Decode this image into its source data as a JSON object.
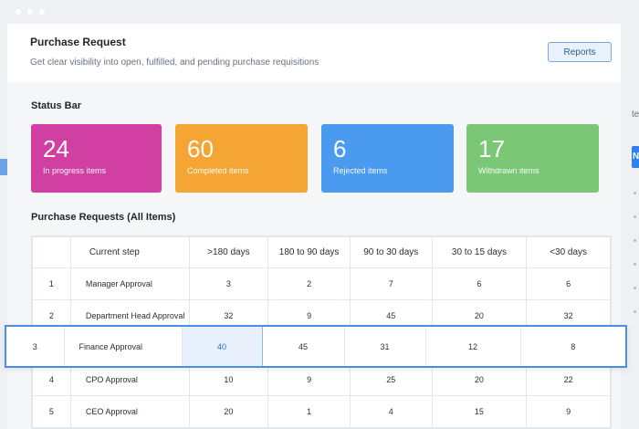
{
  "header": {
    "title": "Purchase Request",
    "subtitle": "Get clear visibility into open, fulfilled, and pending purchase requisitions",
    "reports_label": "Reports"
  },
  "status": {
    "title": "Status Bar",
    "cards": [
      {
        "value": "24",
        "label": "In progress items",
        "color": "#d13fa3"
      },
      {
        "value": "60",
        "label": "Completed items",
        "color": "#f5a534"
      },
      {
        "value": "6",
        "label": "Rejected items",
        "color": "#4a9af0"
      },
      {
        "value": "17",
        "label": "Withdrawn items",
        "color": "#7ac876"
      }
    ]
  },
  "table": {
    "title": "Purchase Requests (All Items)",
    "columns": [
      "",
      "Current step",
      ">180 days",
      "180 to 90 days",
      "90 to 30 days",
      "30 to 15 days",
      "<30 days"
    ],
    "rows": [
      {
        "index": "1",
        "step": "Manager Approval",
        "values": [
          "3",
          "2",
          "7",
          "6",
          "6"
        ]
      },
      {
        "index": "2",
        "step": "Department Head Approval",
        "values": [
          "32",
          "9",
          "45",
          "20",
          "32"
        ]
      },
      {
        "index": "3",
        "step": "Finance Approval",
        "values": [
          "40",
          "45",
          "31",
          "12",
          "8"
        ]
      },
      {
        "index": "4",
        "step": "CPO Approval",
        "values": [
          "10",
          "9",
          "25",
          "20",
          "22"
        ]
      },
      {
        "index": "5",
        "step": "CEO Approval",
        "values": [
          "20",
          "1",
          "4",
          "15",
          "9"
        ]
      }
    ]
  },
  "side": {
    "right_fragment_text": "te",
    "right_button_text": "N"
  }
}
